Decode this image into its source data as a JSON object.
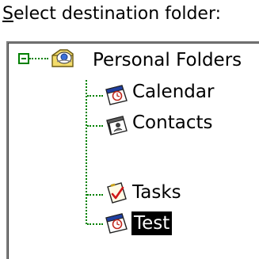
{
  "dialog": {
    "prompt_mnemonic": "S",
    "prompt_rest": "elect destination folder:"
  },
  "tree": {
    "root": {
      "label": "Personal Folders",
      "icon": "personal-folders-icon",
      "expanded": true
    },
    "items": [
      {
        "label": "Calendar",
        "icon": "calendar-icon",
        "selected": false
      },
      {
        "label": "Contacts",
        "icon": "contacts-icon",
        "selected": false
      },
      {
        "label": "Tasks",
        "icon": "tasks-icon",
        "selected": false
      },
      {
        "label": "Test",
        "icon": "calendar-icon",
        "selected": true
      }
    ]
  },
  "colors": {
    "connector": "#008000",
    "selection_bg": "#000000",
    "selection_text": "#ffffff"
  }
}
